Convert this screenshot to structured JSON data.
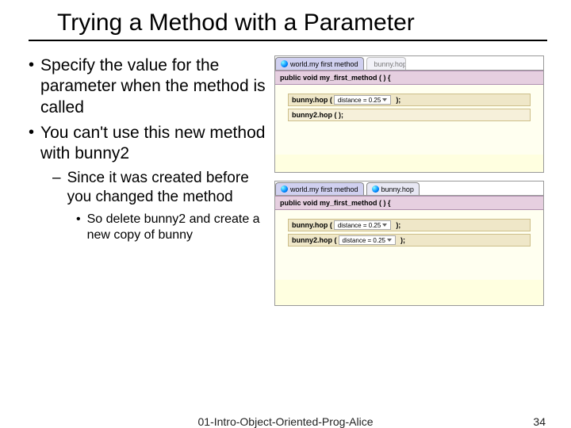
{
  "title": "Trying a Method with a Parameter",
  "bullets": {
    "b1a": "Specify the value for the parameter when the method is called",
    "b1b": "You can't use this new method with bunny2",
    "b2": "Since it was created before you changed the method",
    "b3": "So delete bunny2 and create a new copy of bunny"
  },
  "panel1": {
    "tab1": "world.my first method",
    "tab2": "bunny.hop",
    "sig": "public void my_first_method ( ) {",
    "line1_obj": "bunny.hop (",
    "line1_param": "distance = 0.25",
    "line1_end": ");",
    "loose": "bunny2.hop ( );"
  },
  "panel2": {
    "tab1": "world.my first method",
    "tab2": "bunny.hop",
    "sig": "public void my_first_method ( ) {",
    "line1_obj": "bunny.hop (",
    "line1_param": "distance = 0.25",
    "line1_end": ");",
    "line2_obj": "bunny2.hop (",
    "line2_param": "distance = 0.25",
    "line2_end": ");"
  },
  "footer": {
    "center": "01-Intro-Object-Oriented-Prog-Alice",
    "page": "34"
  }
}
